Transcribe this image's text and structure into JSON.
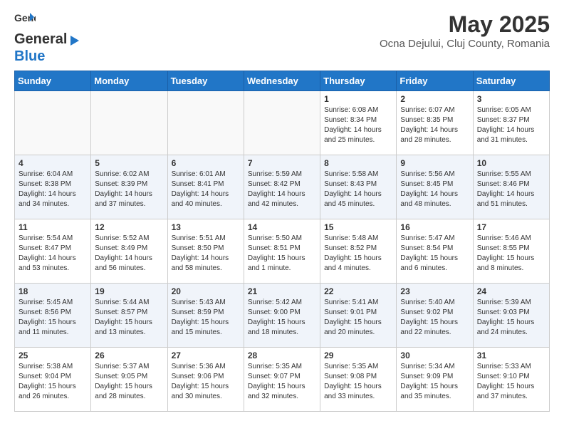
{
  "header": {
    "logo_general": "General",
    "logo_blue": "Blue",
    "title": "May 2025",
    "subtitle": "Ocna Dejului, Cluj County, Romania"
  },
  "days_of_week": [
    "Sunday",
    "Monday",
    "Tuesday",
    "Wednesday",
    "Thursday",
    "Friday",
    "Saturday"
  ],
  "weeks": [
    {
      "shade": "row-white",
      "days": [
        {
          "number": "",
          "info": ""
        },
        {
          "number": "",
          "info": ""
        },
        {
          "number": "",
          "info": ""
        },
        {
          "number": "",
          "info": ""
        },
        {
          "number": "1",
          "info": "Sunrise: 6:08 AM\nSunset: 8:34 PM\nDaylight: 14 hours\nand 25 minutes."
        },
        {
          "number": "2",
          "info": "Sunrise: 6:07 AM\nSunset: 8:35 PM\nDaylight: 14 hours\nand 28 minutes."
        },
        {
          "number": "3",
          "info": "Sunrise: 6:05 AM\nSunset: 8:37 PM\nDaylight: 14 hours\nand 31 minutes."
        }
      ]
    },
    {
      "shade": "row-shaded",
      "days": [
        {
          "number": "4",
          "info": "Sunrise: 6:04 AM\nSunset: 8:38 PM\nDaylight: 14 hours\nand 34 minutes."
        },
        {
          "number": "5",
          "info": "Sunrise: 6:02 AM\nSunset: 8:39 PM\nDaylight: 14 hours\nand 37 minutes."
        },
        {
          "number": "6",
          "info": "Sunrise: 6:01 AM\nSunset: 8:41 PM\nDaylight: 14 hours\nand 40 minutes."
        },
        {
          "number": "7",
          "info": "Sunrise: 5:59 AM\nSunset: 8:42 PM\nDaylight: 14 hours\nand 42 minutes."
        },
        {
          "number": "8",
          "info": "Sunrise: 5:58 AM\nSunset: 8:43 PM\nDaylight: 14 hours\nand 45 minutes."
        },
        {
          "number": "9",
          "info": "Sunrise: 5:56 AM\nSunset: 8:45 PM\nDaylight: 14 hours\nand 48 minutes."
        },
        {
          "number": "10",
          "info": "Sunrise: 5:55 AM\nSunset: 8:46 PM\nDaylight: 14 hours\nand 51 minutes."
        }
      ]
    },
    {
      "shade": "row-white",
      "days": [
        {
          "number": "11",
          "info": "Sunrise: 5:54 AM\nSunset: 8:47 PM\nDaylight: 14 hours\nand 53 minutes."
        },
        {
          "number": "12",
          "info": "Sunrise: 5:52 AM\nSunset: 8:49 PM\nDaylight: 14 hours\nand 56 minutes."
        },
        {
          "number": "13",
          "info": "Sunrise: 5:51 AM\nSunset: 8:50 PM\nDaylight: 14 hours\nand 58 minutes."
        },
        {
          "number": "14",
          "info": "Sunrise: 5:50 AM\nSunset: 8:51 PM\nDaylight: 15 hours\nand 1 minute."
        },
        {
          "number": "15",
          "info": "Sunrise: 5:48 AM\nSunset: 8:52 PM\nDaylight: 15 hours\nand 4 minutes."
        },
        {
          "number": "16",
          "info": "Sunrise: 5:47 AM\nSunset: 8:54 PM\nDaylight: 15 hours\nand 6 minutes."
        },
        {
          "number": "17",
          "info": "Sunrise: 5:46 AM\nSunset: 8:55 PM\nDaylight: 15 hours\nand 8 minutes."
        }
      ]
    },
    {
      "shade": "row-shaded",
      "days": [
        {
          "number": "18",
          "info": "Sunrise: 5:45 AM\nSunset: 8:56 PM\nDaylight: 15 hours\nand 11 minutes."
        },
        {
          "number": "19",
          "info": "Sunrise: 5:44 AM\nSunset: 8:57 PM\nDaylight: 15 hours\nand 13 minutes."
        },
        {
          "number": "20",
          "info": "Sunrise: 5:43 AM\nSunset: 8:59 PM\nDaylight: 15 hours\nand 15 minutes."
        },
        {
          "number": "21",
          "info": "Sunrise: 5:42 AM\nSunset: 9:00 PM\nDaylight: 15 hours\nand 18 minutes."
        },
        {
          "number": "22",
          "info": "Sunrise: 5:41 AM\nSunset: 9:01 PM\nDaylight: 15 hours\nand 20 minutes."
        },
        {
          "number": "23",
          "info": "Sunrise: 5:40 AM\nSunset: 9:02 PM\nDaylight: 15 hours\nand 22 minutes."
        },
        {
          "number": "24",
          "info": "Sunrise: 5:39 AM\nSunset: 9:03 PM\nDaylight: 15 hours\nand 24 minutes."
        }
      ]
    },
    {
      "shade": "row-white",
      "days": [
        {
          "number": "25",
          "info": "Sunrise: 5:38 AM\nSunset: 9:04 PM\nDaylight: 15 hours\nand 26 minutes."
        },
        {
          "number": "26",
          "info": "Sunrise: 5:37 AM\nSunset: 9:05 PM\nDaylight: 15 hours\nand 28 minutes."
        },
        {
          "number": "27",
          "info": "Sunrise: 5:36 AM\nSunset: 9:06 PM\nDaylight: 15 hours\nand 30 minutes."
        },
        {
          "number": "28",
          "info": "Sunrise: 5:35 AM\nSunset: 9:07 PM\nDaylight: 15 hours\nand 32 minutes."
        },
        {
          "number": "29",
          "info": "Sunrise: 5:35 AM\nSunset: 9:08 PM\nDaylight: 15 hours\nand 33 minutes."
        },
        {
          "number": "30",
          "info": "Sunrise: 5:34 AM\nSunset: 9:09 PM\nDaylight: 15 hours\nand 35 minutes."
        },
        {
          "number": "31",
          "info": "Sunrise: 5:33 AM\nSunset: 9:10 PM\nDaylight: 15 hours\nand 37 minutes."
        }
      ]
    }
  ]
}
